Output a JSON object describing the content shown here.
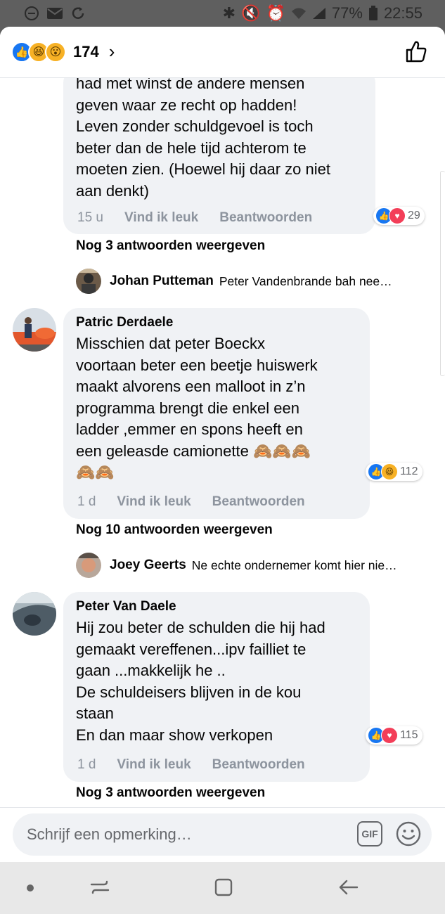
{
  "status_bar": {
    "battery": "77%",
    "time": "22:55"
  },
  "header": {
    "reaction_count": "174",
    "chevron": "›"
  },
  "comments": [
    {
      "text": "had met winst de andere mensen\ngeven waar ze recht op hadden!\nLeven zonder schuldgevoel is toch\nbeter dan de hele tijd achterom te\nmoeten zien. (Hoewel hij daar zo niet\naan denkt)",
      "reactions": "29",
      "time": "15 u",
      "like": "Vind ik leuk",
      "reply": "Beantwoorden",
      "more_replies": "Nog 3 antwoorden weergeven",
      "preview_name": "Johan Putteman",
      "preview_text": "Peter Vandenbrande bah nee…"
    },
    {
      "author": "Patric Derdaele",
      "text": "Misschien dat peter Boeckx\nvoortaan beter een beetje huiswerk\nmaakt alvorens een malloot in z’n\nprogramma brengt die enkel een\nladder ,emmer en spons heeft en\neen geleasde camionette 🙈🙈🙈\n🙈🙈",
      "reactions": "112",
      "time": "1 d",
      "like": "Vind ik leuk",
      "reply": "Beantwoorden",
      "more_replies": "Nog 10 antwoorden weergeven",
      "preview_name": "Joey Geerts",
      "preview_text": "Ne echte ondernemer komt hier nie…"
    },
    {
      "author": "Peter Van Daele",
      "text": "Hij zou beter de schulden die hij had\ngemaakt vereffenen...ipv failliet te\ngaan ...makkelijk he ..\nDe schuldeisers blijven in de kou\nstaan\nEn dan maar show verkopen",
      "reactions": "115",
      "time": "1 d",
      "like": "Vind ik leuk",
      "reply": "Beantwoorden",
      "more_replies": "Nog 3 antwoorden weergeven"
    }
  ],
  "composer": {
    "placeholder": "Schrijf een opmerking…",
    "gif": "GIF"
  },
  "colors": {
    "accent": "#1877f2",
    "love": "#f33e58",
    "haha": "#f7b125",
    "bubble": "#f0f2f5",
    "meta": "#8d949e"
  }
}
